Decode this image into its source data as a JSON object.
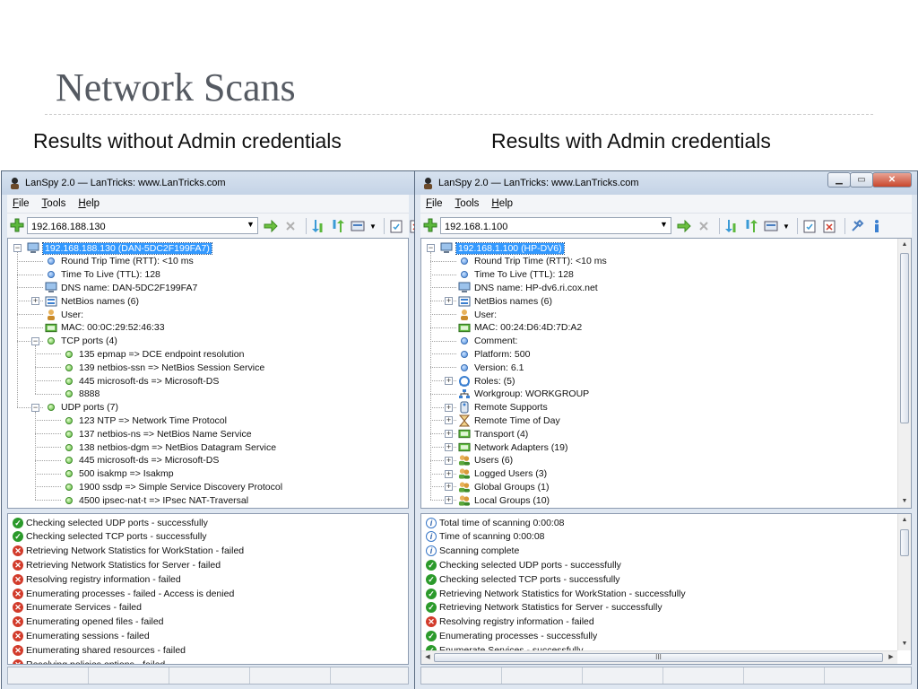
{
  "slide": {
    "title": "Network Scans",
    "caption_left": "Results without Admin credentials",
    "caption_right": "Results with Admin credentials"
  },
  "windows": [
    {
      "title": "LanSpy 2.0 — LanTricks: www.LanTricks.com",
      "menu": [
        "File",
        "Tools",
        "Help"
      ],
      "address": "192.168.188.130",
      "tree": [
        {
          "text": "192.168.188.130 (DAN-5DC2F199FA7)",
          "level": 0,
          "icon": "computer",
          "expander": "-",
          "selected": true
        },
        {
          "text": "Round Trip Time (RTT): <10 ms",
          "level": 1,
          "icon": "dot-blue"
        },
        {
          "text": "Time To Live (TTL): 128",
          "level": 1,
          "icon": "dot-blue"
        },
        {
          "text": "DNS name: DAN-5DC2F199FA7",
          "level": 1,
          "icon": "computer"
        },
        {
          "text": "NetBios names (6)",
          "level": 1,
          "icon": "list",
          "expander": "+"
        },
        {
          "text": "User:",
          "level": 1,
          "icon": "user"
        },
        {
          "text": "MAC: 00:0C:29:52:46:33",
          "level": 1,
          "icon": "nic"
        },
        {
          "text": "TCP ports (4)",
          "level": 1,
          "icon": "dot-green",
          "expander": "-"
        },
        {
          "text": "135 epmap => DCE endpoint resolution",
          "level": 2,
          "icon": "dot-green"
        },
        {
          "text": "139 netbios-ssn => NetBios Session Service",
          "level": 2,
          "icon": "dot-green"
        },
        {
          "text": "445 microsoft-ds => Microsoft-DS",
          "level": 2,
          "icon": "dot-green"
        },
        {
          "text": "8888",
          "level": 2,
          "icon": "dot-green"
        },
        {
          "text": "UDP ports (7)",
          "level": 1,
          "icon": "dot-green",
          "expander": "-"
        },
        {
          "text": "123 NTP => Network Time Protocol",
          "level": 2,
          "icon": "dot-green"
        },
        {
          "text": "137 netbios-ns => NetBios Name Service",
          "level": 2,
          "icon": "dot-green"
        },
        {
          "text": "138 netbios-dgm => NetBios Datagram Service",
          "level": 2,
          "icon": "dot-green"
        },
        {
          "text": "445 microsoft-ds => Microsoft-DS",
          "level": 2,
          "icon": "dot-green"
        },
        {
          "text": "500 isakmp => Isakmp",
          "level": 2,
          "icon": "dot-green"
        },
        {
          "text": "1900 ssdp => Simple Service Discovery Protocol",
          "level": 2,
          "icon": "dot-green"
        },
        {
          "text": "4500 ipsec-nat-t => IPsec NAT-Traversal",
          "level": 2,
          "icon": "dot-green"
        }
      ],
      "log": [
        {
          "text": "Checking selected UDP ports - successfully",
          "status": "ok"
        },
        {
          "text": "Checking selected TCP ports - successfully",
          "status": "ok"
        },
        {
          "text": "Retrieving Network Statistics for WorkStation - failed",
          "status": "fail"
        },
        {
          "text": "Retrieving Network Statistics for Server - failed",
          "status": "fail"
        },
        {
          "text": "Resolving registry information - failed",
          "status": "fail"
        },
        {
          "text": "Enumerating processes - failed - Access is denied",
          "status": "fail"
        },
        {
          "text": "Enumerate Services - failed",
          "status": "fail"
        },
        {
          "text": "Enumerating opened files - failed",
          "status": "fail"
        },
        {
          "text": "Enumerating sessions - failed",
          "status": "fail"
        },
        {
          "text": "Enumerating shared resources - failed",
          "status": "fail"
        },
        {
          "text": "Resolving policies options - failed",
          "status": "fail"
        }
      ]
    },
    {
      "title": "LanSpy 2.0 — LanTricks: www.LanTricks.com",
      "menu": [
        "File",
        "Tools",
        "Help"
      ],
      "address": "192.168.1.100",
      "tree": [
        {
          "text": "192.168.1.100 (HP-DV6)",
          "level": 0,
          "icon": "computer",
          "expander": "-",
          "selected": true
        },
        {
          "text": "Round Trip Time (RTT): <10 ms",
          "level": 1,
          "icon": "dot-blue"
        },
        {
          "text": "Time To Live (TTL): 128",
          "level": 1,
          "icon": "dot-blue"
        },
        {
          "text": "DNS name: HP-dv6.ri.cox.net",
          "level": 1,
          "icon": "computer"
        },
        {
          "text": "NetBios names (6)",
          "level": 1,
          "icon": "list",
          "expander": "+"
        },
        {
          "text": "User:",
          "level": 1,
          "icon": "user"
        },
        {
          "text": "MAC: 00:24:D6:4D:7D:A2",
          "level": 1,
          "icon": "nic"
        },
        {
          "text": "Comment:",
          "level": 1,
          "icon": "dot-blue"
        },
        {
          "text": "Platform: 500",
          "level": 1,
          "icon": "dot-blue"
        },
        {
          "text": "Version: 6.1",
          "level": 1,
          "icon": "dot-blue"
        },
        {
          "text": "Roles: (5)",
          "level": 1,
          "icon": "roles",
          "expander": "+"
        },
        {
          "text": "Workgroup: WORKGROUP",
          "level": 1,
          "icon": "workgroup"
        },
        {
          "text": "Remote Supports",
          "level": 1,
          "icon": "remote",
          "expander": "+"
        },
        {
          "text": "Remote Time of Day",
          "level": 1,
          "icon": "hourglass",
          "expander": "+"
        },
        {
          "text": "Transport (4)",
          "level": 1,
          "icon": "nic",
          "expander": "+"
        },
        {
          "text": "Network Adapters (19)",
          "level": 1,
          "icon": "nic",
          "expander": "+"
        },
        {
          "text": "Users (6)",
          "level": 1,
          "icon": "users",
          "expander": "+"
        },
        {
          "text": "Logged Users (3)",
          "level": 1,
          "icon": "users",
          "expander": "+"
        },
        {
          "text": "Global Groups (1)",
          "level": 1,
          "icon": "users",
          "expander": "+"
        },
        {
          "text": "Local Groups (10)",
          "level": 1,
          "icon": "users",
          "expander": "+"
        }
      ],
      "log": [
        {
          "text": "Total time of scanning 0:00:08",
          "status": "info"
        },
        {
          "text": "Time of scanning 0:00:08",
          "status": "info"
        },
        {
          "text": "Scanning complete",
          "status": "info"
        },
        {
          "text": "Checking selected UDP ports - successfully",
          "status": "ok"
        },
        {
          "text": "Checking selected TCP ports - successfully",
          "status": "ok"
        },
        {
          "text": "Retrieving Network Statistics for WorkStation - successfully",
          "status": "ok"
        },
        {
          "text": "Retrieving Network Statistics for Server - successfully",
          "status": "ok"
        },
        {
          "text": "Resolving registry information - failed",
          "status": "fail"
        },
        {
          "text": "Enumerating processes - successfully",
          "status": "ok"
        },
        {
          "text": "Enumerate Services - successfully",
          "status": "ok"
        }
      ],
      "hscroll_label": "III"
    }
  ],
  "colors": {
    "title_text": "#555a62",
    "selection": "#3399ff",
    "ok": "#2b9a2b",
    "fail": "#d23b2b",
    "info": "#3877c8"
  }
}
